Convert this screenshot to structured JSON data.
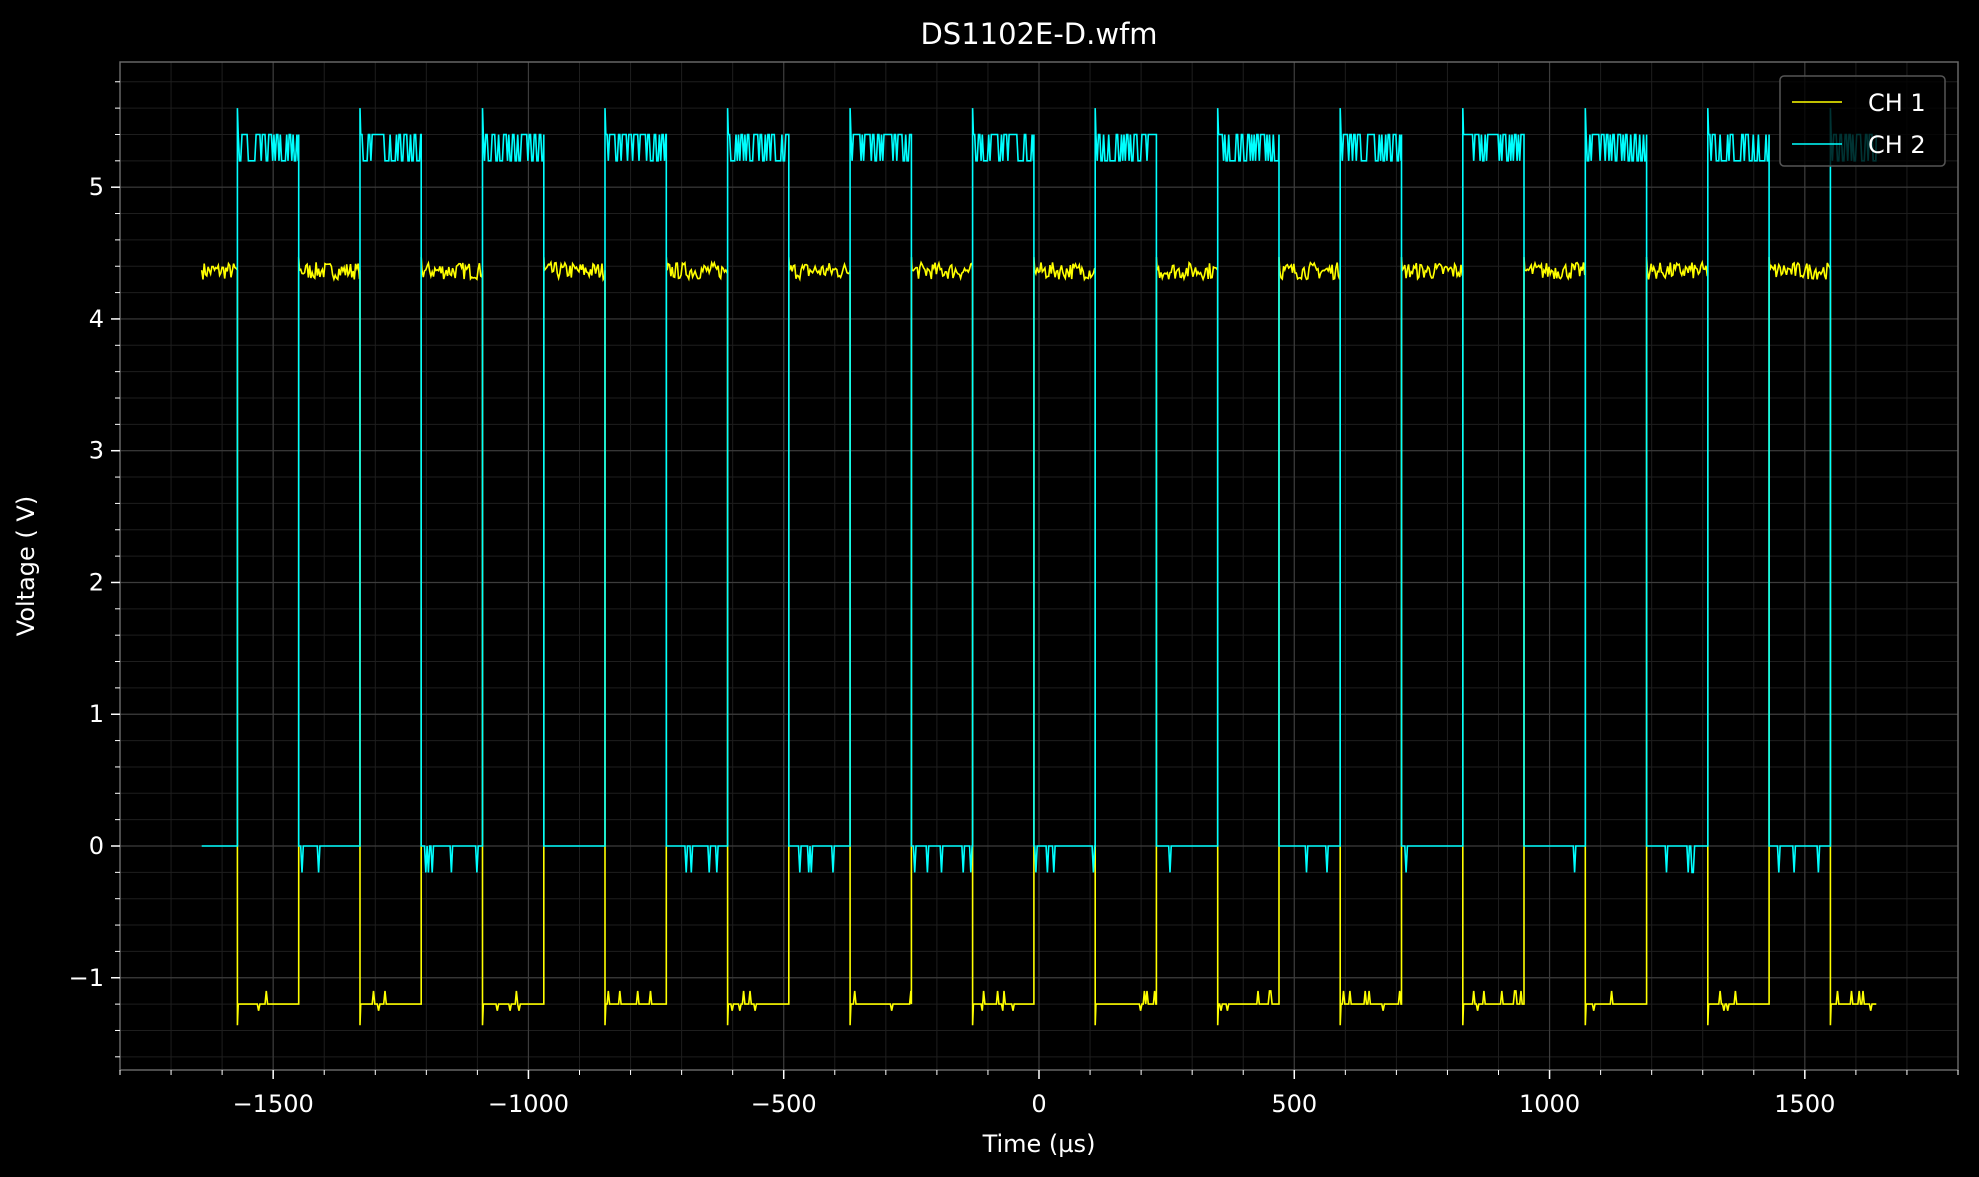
{
  "chart_data": {
    "type": "line",
    "title": "DS1102E-D.wfm",
    "xlabel": "Time (µs)",
    "ylabel": "Voltage ( V)",
    "xlim": [
      -1800,
      1800
    ],
    "ylim": [
      -1.7,
      5.95
    ],
    "xticks": [
      -1500,
      -1000,
      -500,
      0,
      500,
      1000,
      1500
    ],
    "xtick_labels": [
      "−1500",
      "−1000",
      "−500",
      "0",
      "500",
      "1000",
      "1500"
    ],
    "yticks": [
      -1,
      0,
      1,
      2,
      3,
      4,
      5
    ],
    "ytick_labels": [
      "−1",
      "0",
      "1",
      "2",
      "3",
      "4",
      "5"
    ],
    "grid": true,
    "minor_grid": true,
    "legend": "top-right",
    "background": "#000000",
    "waveform": {
      "t_start": -1640,
      "t_end": 1640,
      "period": 240,
      "first_edge": -1570,
      "duty_high_ch2": 120
    },
    "series": [
      {
        "name": "CH 1",
        "color": "#ffff00",
        "high_level": 4.37,
        "low_level": -1.2,
        "noise_band": [
          4.3,
          4.43
        ],
        "low_noise_band": [
          -1.28,
          -1.1
        ]
      },
      {
        "name": "CH 2",
        "color": "#00ffff",
        "high_level": 5.4,
        "low_level": 0.0,
        "noise_band": [
          5.2,
          5.4
        ],
        "low_noise_band": [
          -0.2,
          0.0
        ]
      }
    ]
  }
}
